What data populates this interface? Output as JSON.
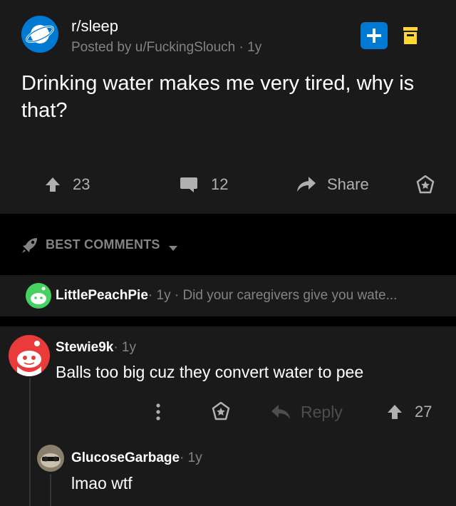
{
  "post": {
    "subreddit": "r/sleep",
    "posted_by": "Posted by u/FuckingSlouch · 1y",
    "title": "Drinking water makes me very tired, why is that?",
    "upvotes": "23",
    "comments": "12",
    "share_label": "Share"
  },
  "sort": {
    "label": "BEST COMMENTS"
  },
  "collapsed_comment": {
    "user": "LittlePeachPie",
    "meta": " · 1y · Did your caregivers give you wate..."
  },
  "comment": {
    "user": "Stewie9k",
    "meta": " · 1y",
    "body": "Balls too big cuz they convert water to pee",
    "reply_label": "Reply",
    "score": "27"
  },
  "reply": {
    "user": "GlucoseGarbage",
    "meta": " · 1y",
    "body": "lmao wtf"
  },
  "colors": {
    "background": "#000000",
    "card": "#1a1a1b",
    "accent_blue": "#0079d3",
    "archive_yellow": "#ffd635",
    "muted_text": "#818384"
  },
  "icons": [
    "planet-icon",
    "plus-icon",
    "archive-icon",
    "upvote-icon",
    "comment-icon",
    "share-arrow-icon",
    "award-icon",
    "rocket-icon",
    "chevron-down-icon",
    "snoo-avatar-icon",
    "more-vertical-icon",
    "reply-icon"
  ]
}
